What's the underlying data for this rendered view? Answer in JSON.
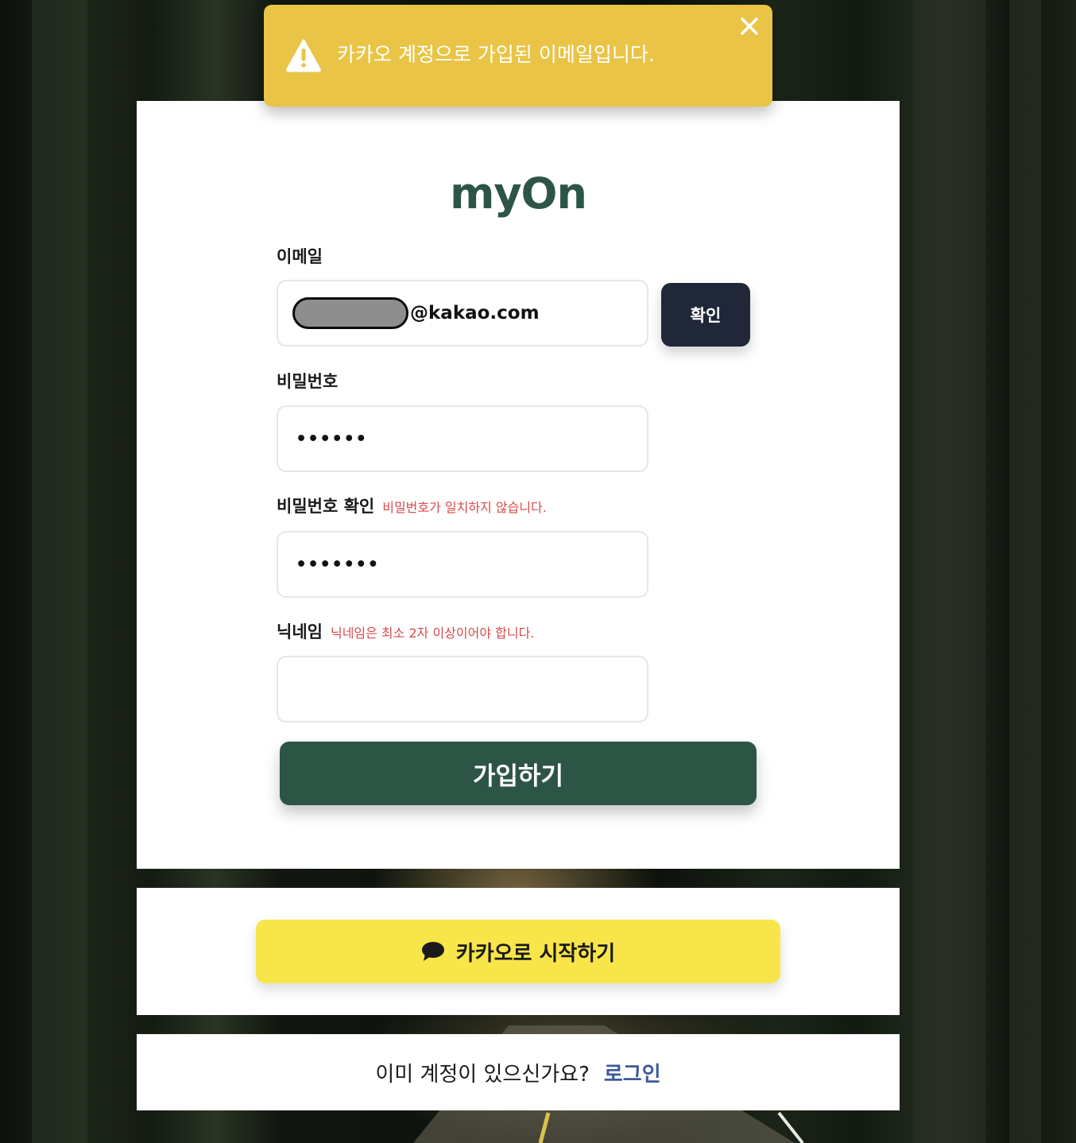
{
  "toast": {
    "message": "카카오 계정으로 가입된 이메일입니다.",
    "icon": "warning-icon",
    "close_icon": "close-icon",
    "color": "#e9c446"
  },
  "brand": {
    "logo": "myOn",
    "color": "#2c5545"
  },
  "form": {
    "email": {
      "label": "이메일",
      "domain": "@kakao.com",
      "confirm_label": "확인"
    },
    "password": {
      "label": "비밀번호",
      "value_masked": "••••••"
    },
    "password_confirm": {
      "label": "비밀번호 확인",
      "error": "비밀번호가 일치하지 않습니다.",
      "value_masked": "•••••••"
    },
    "nickname": {
      "label": "닉네임",
      "error": "닉네임은 최소 2자 이상이어야 합니다.",
      "value": ""
    },
    "submit_label": "가입하기"
  },
  "kakao": {
    "label": "카카오로 시작하기",
    "icon": "chat-bubble-icon",
    "color": "#f8e54a"
  },
  "login": {
    "prompt": "이미 계정이 있으신가요?",
    "link": "로그인"
  }
}
